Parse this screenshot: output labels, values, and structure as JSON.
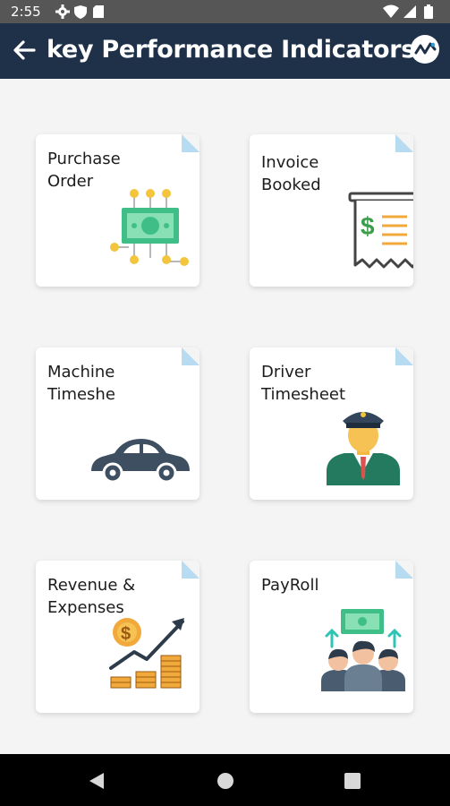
{
  "status_bar": {
    "time": "2:55"
  },
  "app_bar": {
    "title": "key Performance Indicators"
  },
  "cards": [
    {
      "label": "Purchase\nOrder"
    },
    {
      "label": "Invoice\nBooked"
    },
    {
      "label": "Machine\nTimeshe"
    },
    {
      "label": "Driver\nTimesheet"
    },
    {
      "label": "Revenue &\nExpenses"
    },
    {
      "label": "PayRoll"
    }
  ],
  "icons": {
    "back": "back-arrow-icon",
    "logo": "app-logo",
    "nav": [
      "back-triangle-icon",
      "home-circle-icon",
      "recents-square-icon"
    ]
  },
  "colors": {
    "status_bar": "#565656",
    "app_bar": "#1e3148",
    "background": "#f4f4f4",
    "card_fold": "#b7dbf0"
  }
}
